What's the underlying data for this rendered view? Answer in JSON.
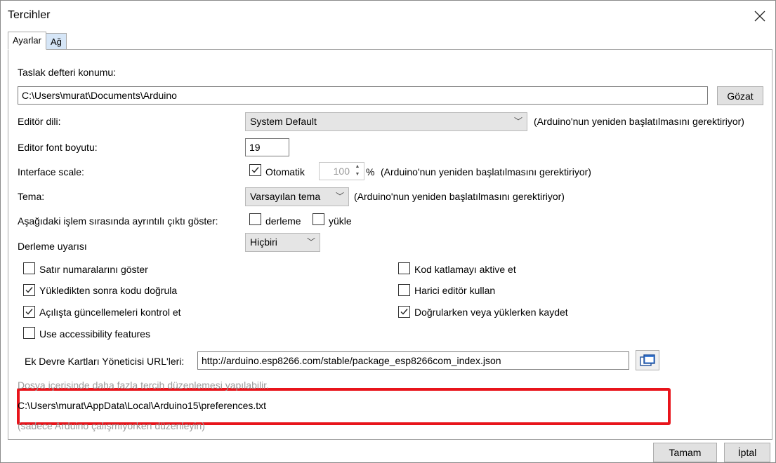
{
  "window": {
    "title": "Tercihler"
  },
  "tabs": [
    {
      "label": "Ayarlar"
    },
    {
      "label": "Ağ"
    }
  ],
  "sketchbook": {
    "label": "Taslak defteri konumu:",
    "value": "C:\\Users\\murat\\Documents\\Arduino",
    "browse_label": "Gözat"
  },
  "editor_language": {
    "label": "Editör dili:",
    "value": "System Default",
    "note": "(Arduino'nun yeniden başlatılmasını gerektiriyor)"
  },
  "editor_font": {
    "label": "Editor font boyutu:",
    "value": "19"
  },
  "interface_scale": {
    "label": "Interface scale:",
    "auto_label": "Otomatik",
    "value": "100",
    "unit": "%",
    "note": "(Arduino'nun yeniden başlatılmasını gerektiriyor)"
  },
  "theme": {
    "label": "Tema:",
    "value": "Varsayılan tema",
    "note": "(Arduino'nun yeniden başlatılmasını gerektiriyor)"
  },
  "verbose": {
    "label": "Aşağıdaki işlem sırasında ayrıntılı çıktı göster:",
    "compile_label": "derleme",
    "upload_label": "yükle"
  },
  "compiler_warnings": {
    "label": "Derleme uyarısı",
    "value": "Hiçbiri"
  },
  "checkboxes": {
    "line_numbers": {
      "label": "Satır numaralarını göster",
      "checked": false
    },
    "verify_after_upload": {
      "label": "Yükledikten sonra kodu doğrula",
      "checked": true
    },
    "check_updates": {
      "label": "Açılışta güncellemeleri kontrol et",
      "checked": true
    },
    "accessibility": {
      "label": "Use accessibility features",
      "checked": false
    },
    "code_folding": {
      "label": "Kod katlamayı aktive et",
      "checked": false
    },
    "external_editor": {
      "label": "Harici editör kullan",
      "checked": false
    },
    "save_on_verify": {
      "label": "Doğrularken veya yüklerken kaydet",
      "checked": true
    }
  },
  "board_urls": {
    "label": "Ek Devre Kartları Yöneticisi URL'leri:",
    "value": "http://arduino.esp8266.com/stable/package_esp8266com_index.json"
  },
  "info": {
    "more_prefs": "Dosya içerisinde daha fazla tercih düzenlemesi yapılabilir.",
    "prefs_path": "C:\\Users\\murat\\AppData\\Local\\Arduino15\\preferences.txt",
    "edit_note": "(sadece Arduino çalışmıyorken düzenleyin)"
  },
  "footer": {
    "ok_label": "Tamam",
    "cancel_label": "İptal"
  },
  "colors": {
    "highlight": "#e8141b",
    "inactive_tab": "#d6e6f7"
  }
}
